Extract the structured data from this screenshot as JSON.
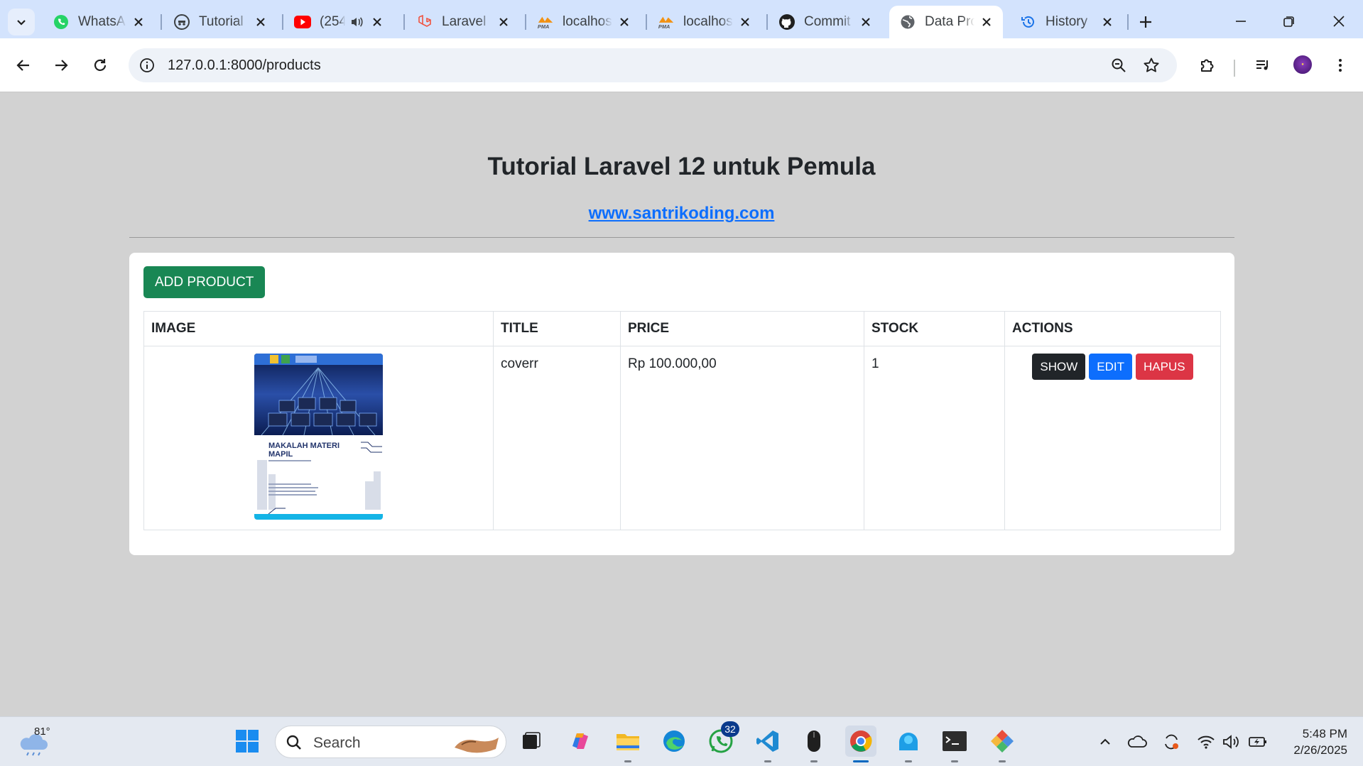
{
  "browser": {
    "tabs": [
      {
        "title": "WhatsApp",
        "icon": "whatsapp-icon"
      },
      {
        "title": "Tutorial",
        "icon": "incognito-icon"
      },
      {
        "title": "(254",
        "icon": "youtube-icon"
      },
      {
        "title": "Laravel",
        "icon": "laravel-icon"
      },
      {
        "title": "localhost",
        "icon": "phpmyadmin-icon"
      },
      {
        "title": "localhost",
        "icon": "phpmyadmin-icon"
      },
      {
        "title": "Commit",
        "icon": "github-icon"
      },
      {
        "title": "Data Products",
        "icon": "globe-icon",
        "active": true
      },
      {
        "title": "History",
        "icon": "history-icon"
      }
    ],
    "url": "127.0.0.1:8000/products"
  },
  "page": {
    "title": "Tutorial Laravel 12 untuk Pemula",
    "link_text": "www.santrikoding.com",
    "add_button": "ADD PRODUCT",
    "table": {
      "headers": {
        "image": "IMAGE",
        "title": "TITLE",
        "price": "PRICE",
        "stock": "STOCK",
        "actions": "ACTIONS"
      },
      "rows": [
        {
          "title": "coverr",
          "price": "Rp 100.000,00",
          "stock": "1",
          "image_caption": "MAKALAH MATERI MAPIL",
          "actions": {
            "show": "SHOW",
            "edit": "EDIT",
            "delete": "HAPUS"
          }
        }
      ]
    }
  },
  "taskbar": {
    "temperature": "81°",
    "search_placeholder": "Search",
    "whatsapp_badge": "32",
    "time": "5:48 PM",
    "date": "2/26/2025"
  },
  "colors": {
    "add": "#198754",
    "show": "#212529",
    "edit": "#0d6efd",
    "delete": "#dc3545",
    "link": "#0d6efd"
  }
}
